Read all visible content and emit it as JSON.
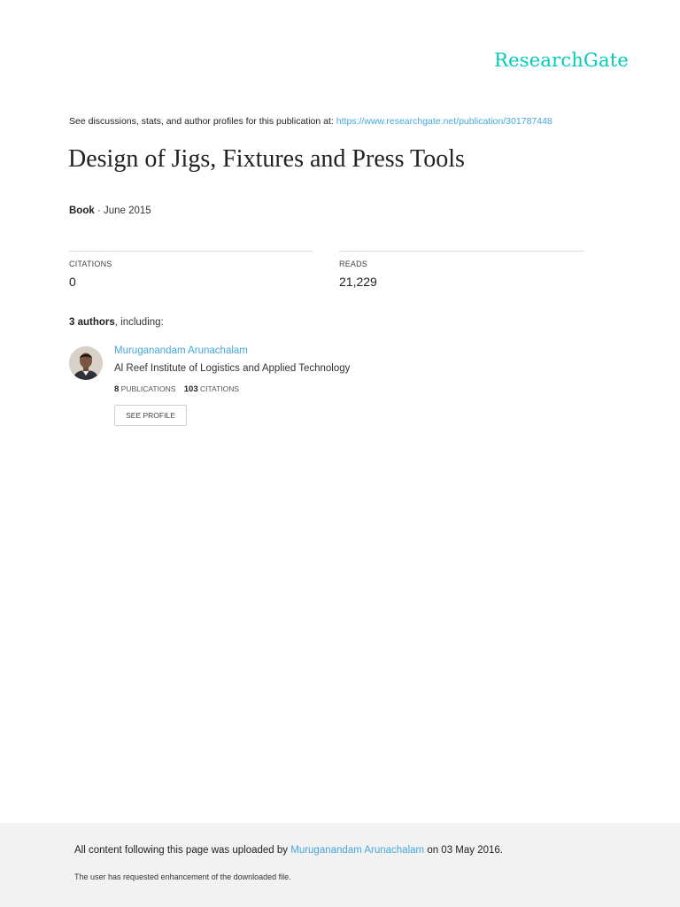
{
  "header": {
    "logo_text": "ResearchGate",
    "brand_color": "#00ccbb"
  },
  "intro": {
    "text": "See discussions, stats, and author profiles for this publication at:",
    "url": "https://www.researchgate.net/publication/301787448"
  },
  "publication": {
    "title": "Design of Jigs, Fixtures and Press Tools",
    "type": "Book",
    "separator": " · ",
    "date": "June 2015"
  },
  "stats": {
    "citations_label": "CITATIONS",
    "citations_value": "0",
    "reads_label": "READS",
    "reads_value": "21,229"
  },
  "authors": {
    "count_text": "3 authors",
    "suffix": ", including:",
    "list": [
      {
        "name": "Muruganandam Arunachalam",
        "institution": "Al Reef Institute of Logistics and Applied Technology",
        "publications_count": "8",
        "publications_label": "Publications",
        "citations_count": "103",
        "citations_label": "Citations",
        "button_label": "SEE PROFILE"
      }
    ]
  },
  "footer": {
    "upload_prefix": "All content following this page was uploaded by",
    "uploader": "Muruganandam Arunachalam",
    "upload_suffix": "on 03 May 2016.",
    "note": "The user has requested enhancement of the downloaded file."
  },
  "colors": {
    "link": "#44a8dd",
    "footer_bg": "#f2f2f2"
  }
}
